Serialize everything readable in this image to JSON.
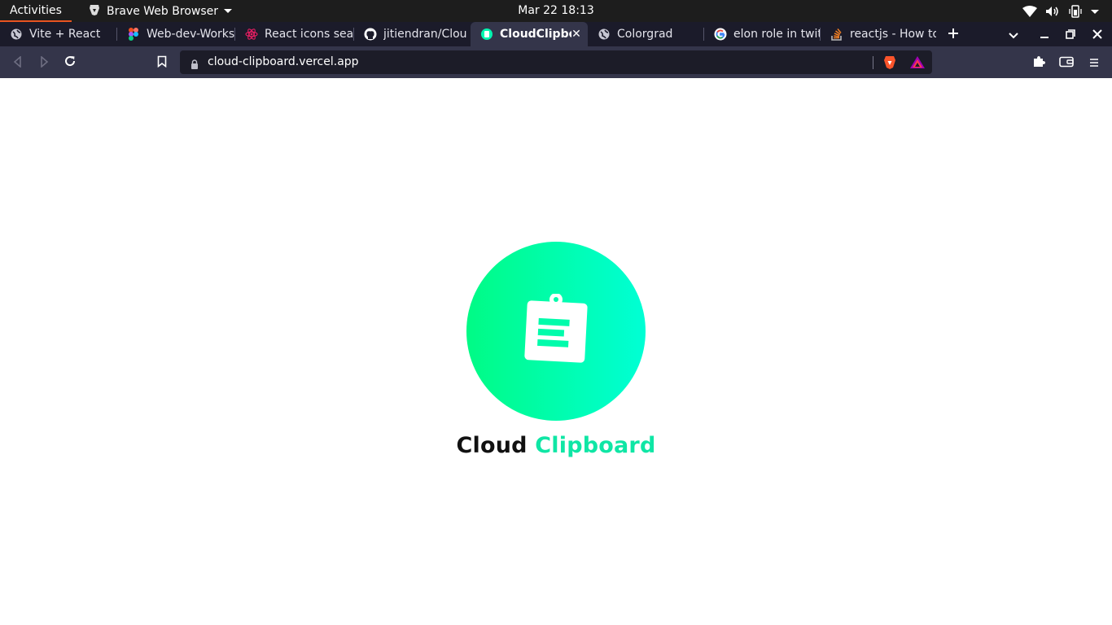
{
  "system_bar": {
    "activities_label": "Activities",
    "app_name": "Brave Web Browser",
    "clock": "Mar 22  18:13"
  },
  "tabs": [
    {
      "title": "Vite + React",
      "icon": "globe-icon",
      "active": false
    },
    {
      "title": "Web-dev-Works",
      "icon": "figma-icon",
      "active": false
    },
    {
      "title": "React icons sea",
      "icon": "react-icon",
      "active": false
    },
    {
      "title": "jitiendran/Clou",
      "icon": "github-icon",
      "active": false
    },
    {
      "title": "CloudClipbo",
      "icon": "cloud-clipboard-favicon",
      "active": true
    },
    {
      "title": "Colorgrad",
      "icon": "globe-icon",
      "active": false
    },
    {
      "title": "elon role in twit",
      "icon": "google-icon",
      "active": false
    },
    {
      "title": "reactjs - How to",
      "icon": "stackoverflow-icon",
      "active": false
    }
  ],
  "toolbar": {
    "url": "cloud-clipboard.vercel.app"
  },
  "page": {
    "brand_word_1": "Cloud",
    "brand_word_2": "Clipboard",
    "accent_color": "#0fe6a5",
    "gradient_start": "#00fb85",
    "gradient_end": "#00ffd5"
  }
}
